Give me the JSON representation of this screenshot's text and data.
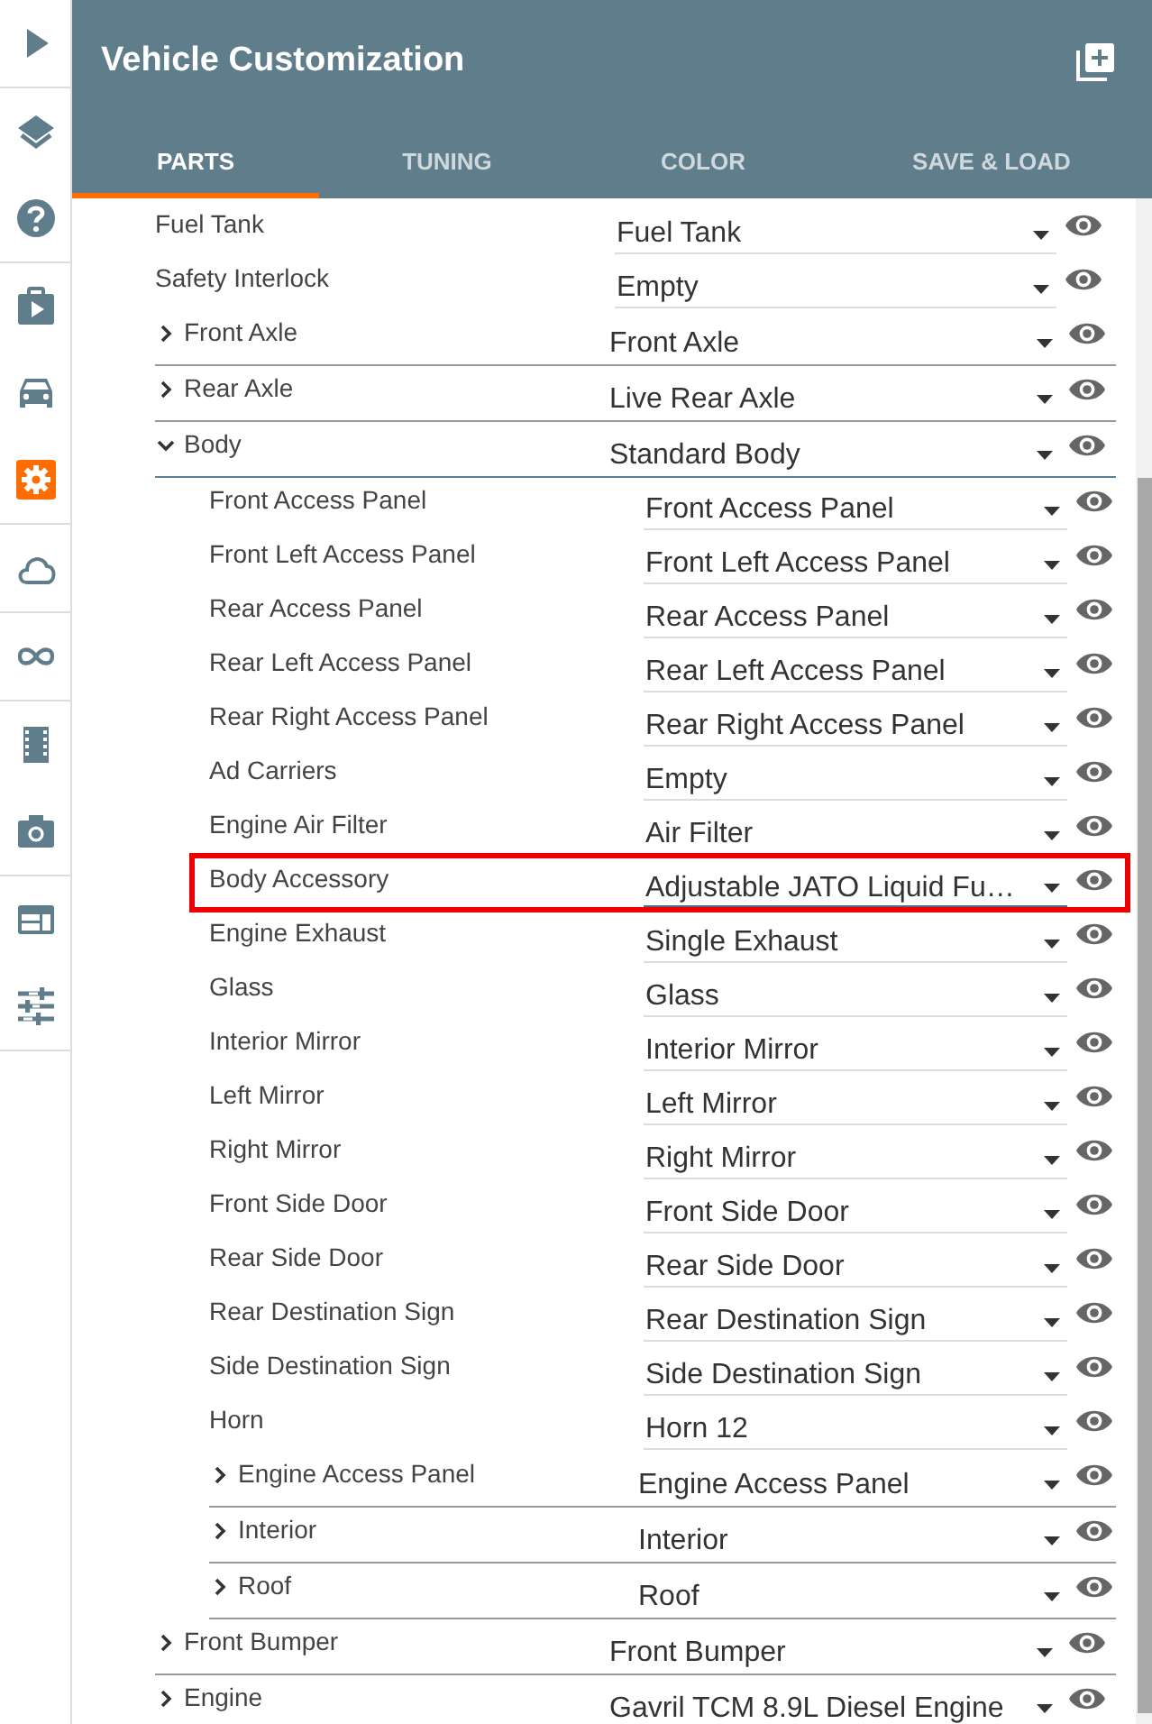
{
  "sidebar": {
    "groups": [
      [
        {
          "kind": "play",
          "selected": false
        }
      ],
      [
        {
          "kind": "layers",
          "selected": false
        },
        {
          "kind": "help",
          "selected": false
        }
      ],
      [
        {
          "kind": "briefcase",
          "selected": false
        },
        {
          "kind": "car",
          "selected": false
        },
        {
          "kind": "gear",
          "selected": true
        }
      ],
      [
        {
          "kind": "cloud",
          "selected": false
        }
      ],
      [
        {
          "kind": "infinity",
          "selected": false
        }
      ],
      [
        {
          "kind": "film",
          "selected": false
        },
        {
          "kind": "camera",
          "selected": false
        }
      ],
      [
        {
          "kind": "window",
          "selected": false
        },
        {
          "kind": "sliders",
          "selected": false
        }
      ]
    ]
  },
  "header": {
    "title": "Vehicle Customization"
  },
  "tabs": [
    {
      "label": "PARTS",
      "selected": true
    },
    {
      "label": "TUNING",
      "selected": false
    },
    {
      "label": "COLOR",
      "selected": false
    },
    {
      "label": "SAVE & LOAD",
      "selected": false
    }
  ],
  "parts": [
    {
      "label": "Fuel Tank",
      "value": "Fuel Tank",
      "kind": "leaf"
    },
    {
      "label": "Safety Interlock",
      "value": "Empty",
      "kind": "leaf"
    },
    {
      "label": "Front Axle",
      "value": "Front Axle",
      "kind": "group",
      "expanded": false
    },
    {
      "label": "Rear Axle",
      "value": "Live Rear Axle",
      "kind": "group",
      "expanded": false
    },
    {
      "label": "Body",
      "value": "Standard Body",
      "kind": "group",
      "expanded": true,
      "children": [
        {
          "label": "Front Access Panel",
          "value": "Front Access Panel",
          "kind": "leaf"
        },
        {
          "label": "Front Left Access Panel",
          "value": "Front Left Access Panel",
          "kind": "leaf"
        },
        {
          "label": "Rear Access Panel",
          "value": "Rear Access Panel",
          "kind": "leaf"
        },
        {
          "label": "Rear Left Access Panel",
          "value": "Rear Left Access Panel",
          "kind": "leaf"
        },
        {
          "label": "Rear Right Access Panel",
          "value": "Rear Right Access Panel",
          "kind": "leaf"
        },
        {
          "label": "Ad Carriers",
          "value": "Empty",
          "kind": "leaf"
        },
        {
          "label": "Engine Air Filter",
          "value": "Air Filter",
          "kind": "leaf"
        },
        {
          "label": "Body Accessory",
          "value": "Adjustable JATO Liquid Fu…",
          "kind": "leaf",
          "highlighted": true
        },
        {
          "label": "Engine Exhaust",
          "value": "Single Exhaust",
          "kind": "leaf"
        },
        {
          "label": "Glass",
          "value": "Glass",
          "kind": "leaf"
        },
        {
          "label": "Interior Mirror",
          "value": "Interior Mirror",
          "kind": "leaf"
        },
        {
          "label": "Left Mirror",
          "value": "Left Mirror",
          "kind": "leaf"
        },
        {
          "label": "Right Mirror",
          "value": "Right Mirror",
          "kind": "leaf"
        },
        {
          "label": "Front Side Door",
          "value": "Front Side Door",
          "kind": "leaf"
        },
        {
          "label": "Rear Side Door",
          "value": "Rear Side Door",
          "kind": "leaf"
        },
        {
          "label": "Rear Destination Sign",
          "value": "Rear Destination Sign",
          "kind": "leaf"
        },
        {
          "label": "Side Destination Sign",
          "value": "Side Destination Sign",
          "kind": "leaf"
        },
        {
          "label": "Horn",
          "value": "Horn 12",
          "kind": "leaf"
        },
        {
          "label": "Engine Access Panel",
          "value": "Engine Access Panel",
          "kind": "group",
          "expanded": false
        },
        {
          "label": "Interior",
          "value": "Interior",
          "kind": "group",
          "expanded": false
        },
        {
          "label": "Roof",
          "value": "Roof",
          "kind": "group",
          "expanded": false
        }
      ]
    },
    {
      "label": "Front Bumper",
      "value": "Front Bumper",
      "kind": "group",
      "expanded": false
    },
    {
      "label": "Engine",
      "value": "Gavril TCM 8.9L Diesel Engine",
      "kind": "group",
      "expanded": false
    }
  ]
}
